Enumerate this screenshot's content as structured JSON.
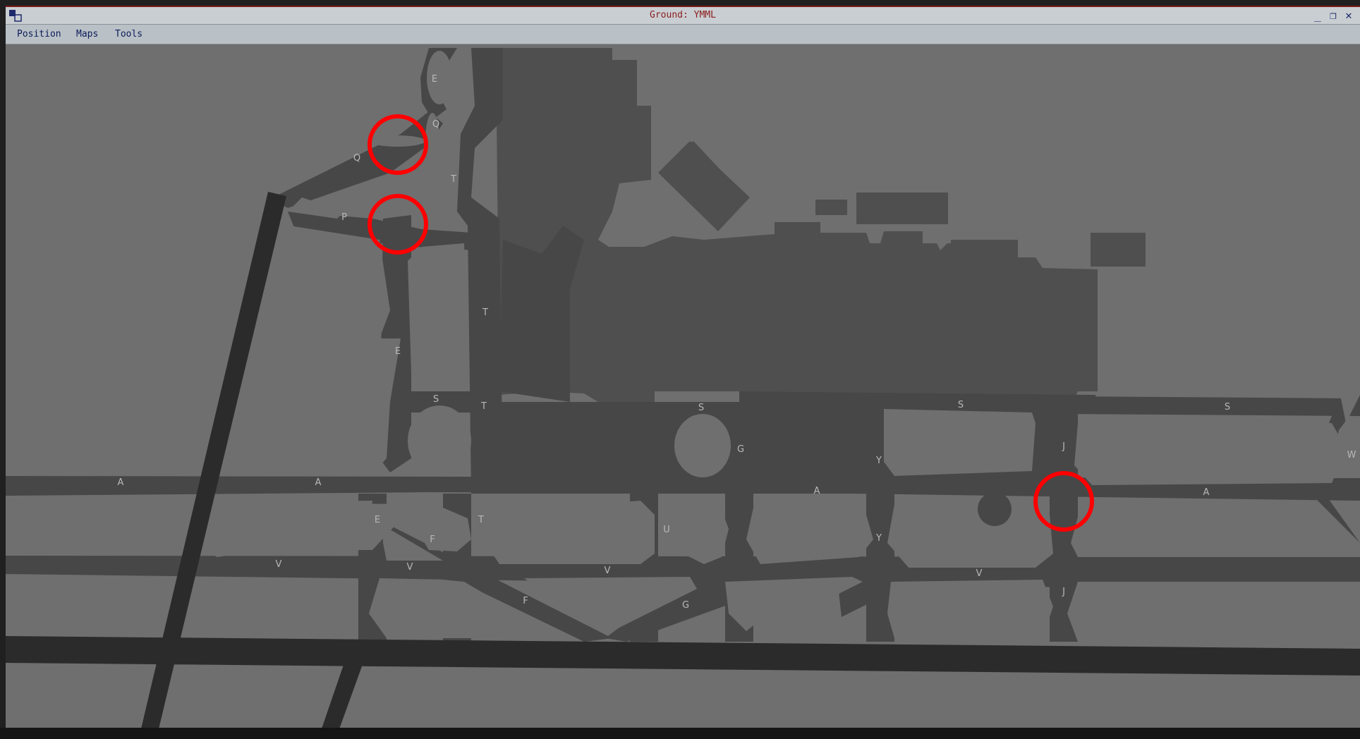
{
  "window": {
    "title": "Ground: YMML",
    "controls": {
      "minimize": "_",
      "maximize": "❐",
      "close": "✕"
    }
  },
  "menu": {
    "items": [
      {
        "id": "position",
        "label": "Position"
      },
      {
        "id": "maps",
        "label": "Maps"
      },
      {
        "id": "tools",
        "label": "Tools"
      }
    ]
  },
  "map": {
    "colors": {
      "ground": "#6f6f6f",
      "taxiway": "#474747",
      "runway": "#2b2b2b",
      "terminal": "#4f4f4f",
      "label": "#b8b8b8",
      "highlight": "#ff0000"
    },
    "taxiway_labels": {
      "e_top": "E",
      "q_top": "Q",
      "q_left": "Q",
      "t_upper": "T",
      "p": "P",
      "t_mid": "T",
      "e_mid": "E",
      "s_left": "S",
      "t_lower": "T",
      "s_center": "S",
      "g_upper": "G",
      "s_right1": "S",
      "s_right2": "S",
      "j_upper": "J",
      "y_upper": "Y",
      "w": "W",
      "a1": "A",
      "a2": "A",
      "a3": "A",
      "a4": "A",
      "e_lower": "E",
      "t_bottom": "T",
      "f_upper": "F",
      "u": "U",
      "y_lower": "Y",
      "v1": "V",
      "v2": "V",
      "v3": "V",
      "v4": "V",
      "f_lower": "F",
      "g_lower": "G",
      "j_lower": "J"
    },
    "highlight_markers": 3
  }
}
